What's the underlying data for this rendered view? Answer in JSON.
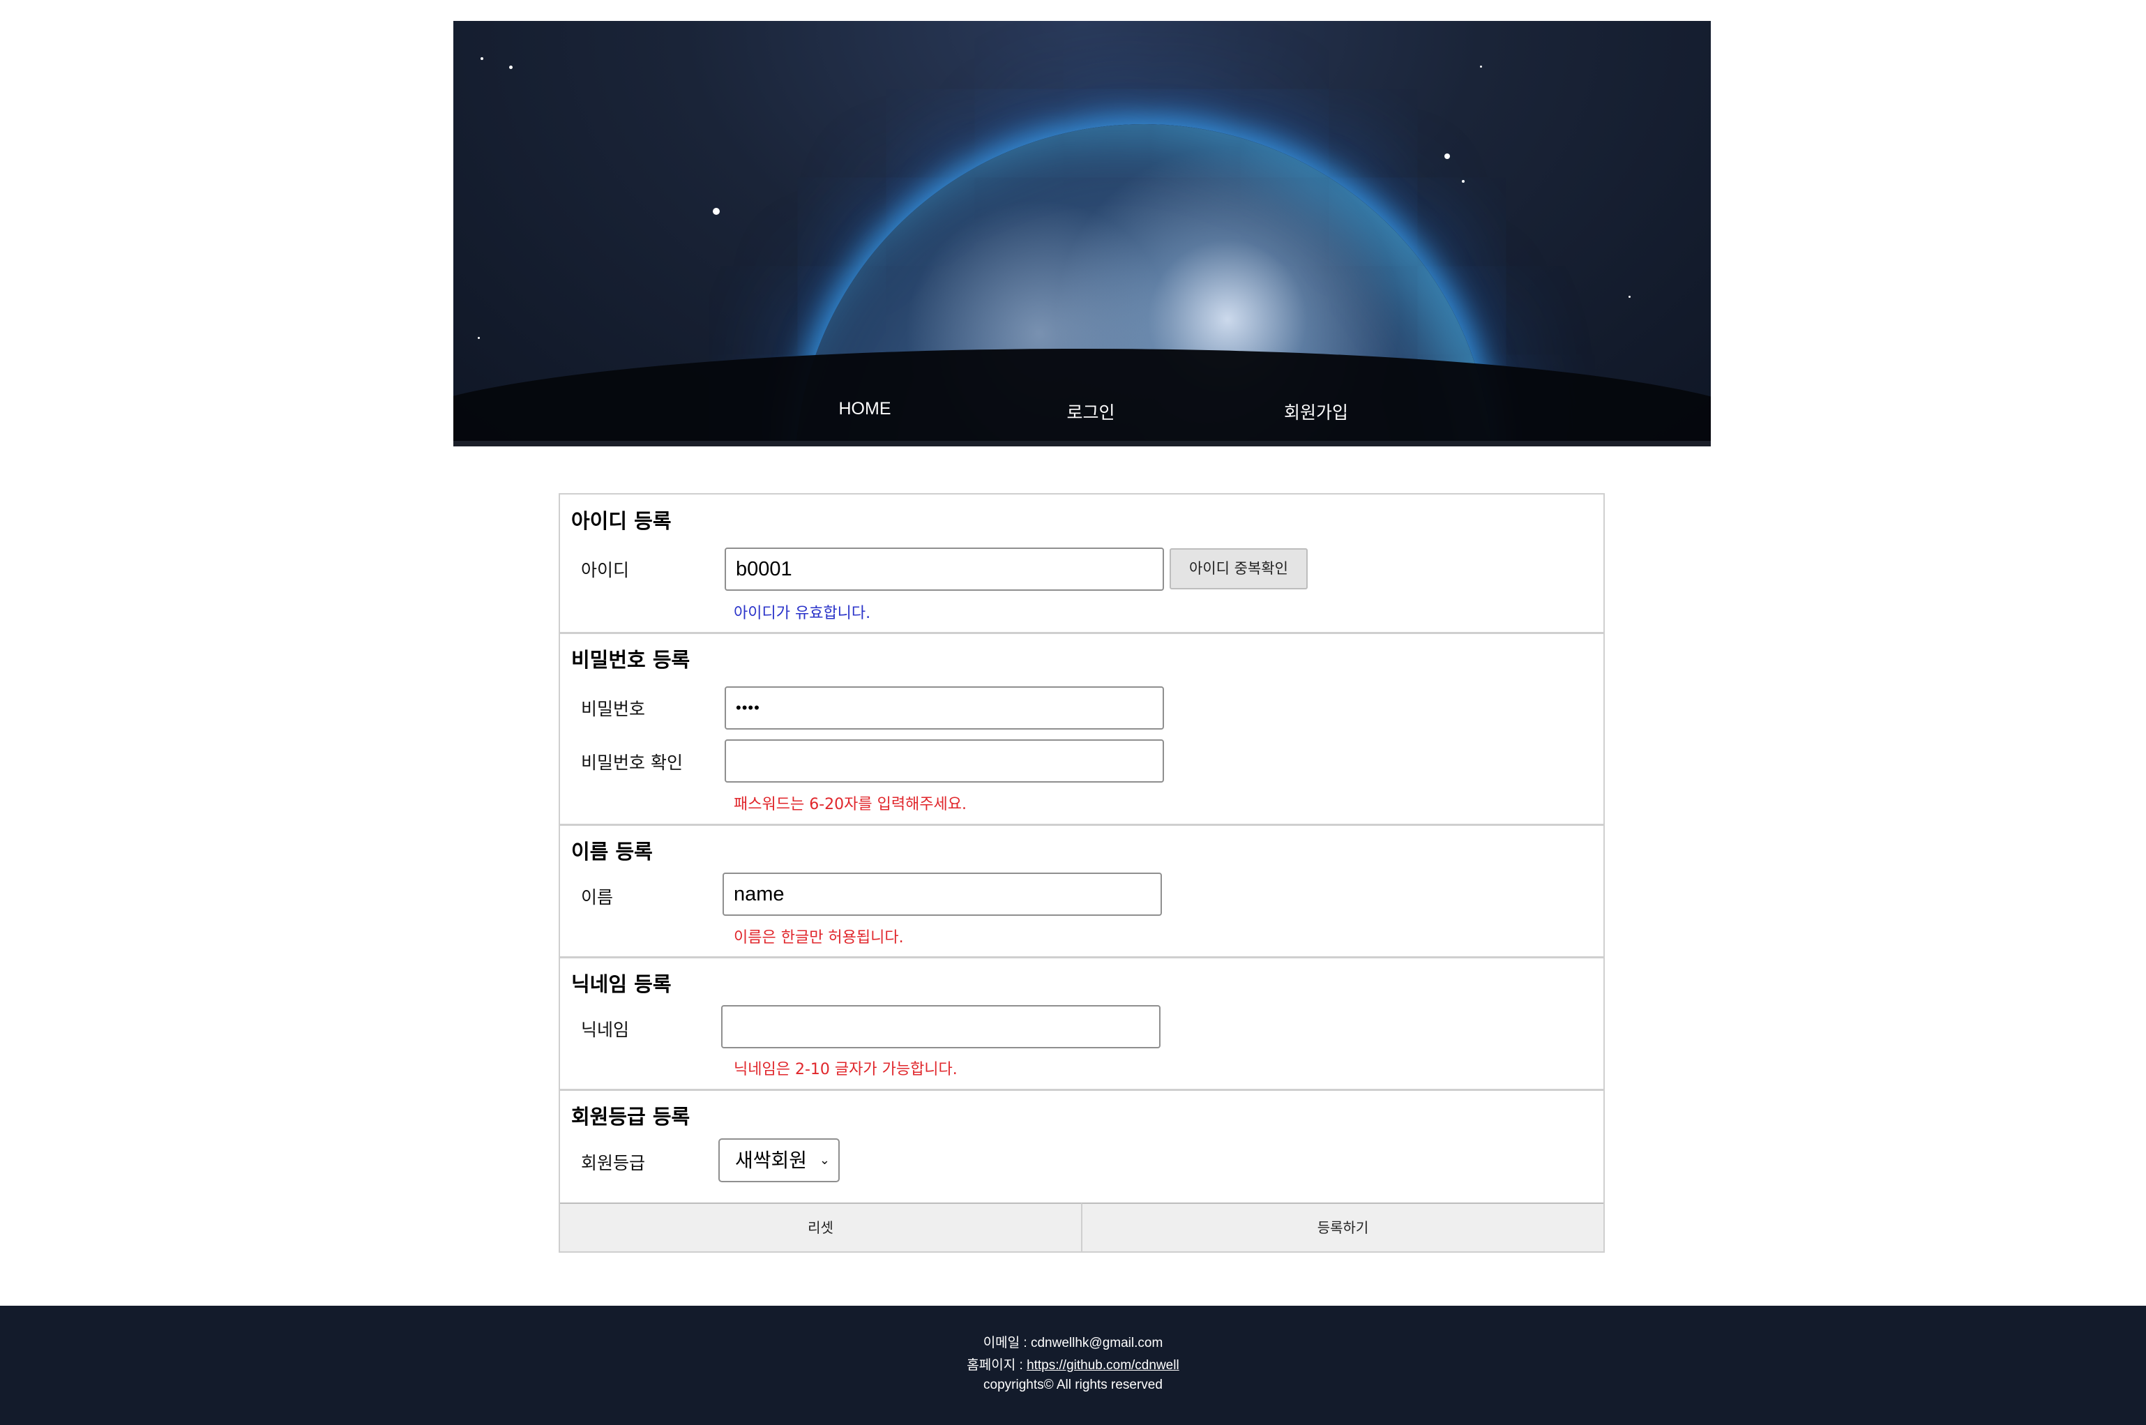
{
  "nav": {
    "home": "HOME",
    "login": "로그인",
    "signup": "회원가입"
  },
  "form": {
    "id_section": {
      "title": "아이디 등록",
      "label": "아이디",
      "value": "b0001",
      "dup_button": "아이디 중복확인",
      "message": "아이디가 유효합니다."
    },
    "pw_section": {
      "title": "비밀번호 등록",
      "pw_label": "비밀번호",
      "pw_value": "••••",
      "confirm_label": "비밀번호 확인",
      "confirm_value": "",
      "message": "패스워드는 6-20자를 입력해주세요."
    },
    "name_section": {
      "title": "이름 등록",
      "label": "이름",
      "value": "name",
      "message": "이름은 한글만 허용됩니다."
    },
    "nick_section": {
      "title": "닉네임 등록",
      "label": "닉네임",
      "value": "",
      "message": "닉네임은 2-10 글자가 가능합니다."
    },
    "grade_section": {
      "title": "회원등급 등록",
      "label": "회원등급",
      "selected": "새싹회원"
    },
    "actions": {
      "reset": "리셋",
      "submit": "등록하기"
    }
  },
  "footer": {
    "email_label": "이메일 : ",
    "email": "cdnwellhk@gmail.com",
    "homepage_label": "홈페이지 : ",
    "homepage": "https://github.com/cdnwell",
    "copyright": "copyrights© All rights reserved"
  },
  "colors": {
    "ok_message": "#2a33c9",
    "error_message": "#e0262b",
    "footer_bg": "#131b2b"
  }
}
